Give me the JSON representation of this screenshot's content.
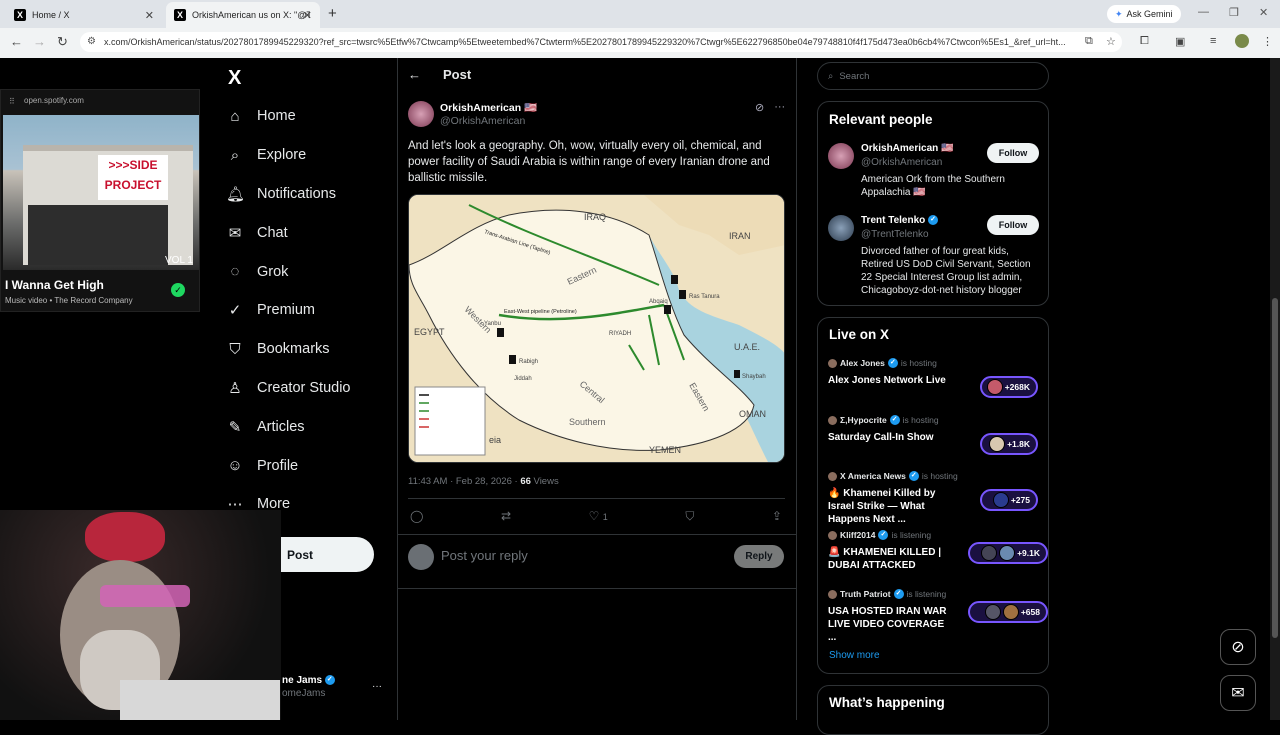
{
  "browser": {
    "tabs": [
      {
        "label": "Home / X"
      },
      {
        "label": "OrkishAmerican us on X: \"@Tre"
      }
    ],
    "new_tab": "+",
    "gemini": "Ask Gemini",
    "url": "x.com/OrkishAmerican/status/2027801789945229320?ref_src=twsrc%5Etfw%7Ctwcamp%5Etweetembed%7Ctwterm%5E2027801789945229320%7Ctwgr%5E622796850be04e79748810f4f175d473ea0b6cb4%7Ctwcon%5Es1_&ref_url=ht..."
  },
  "spotify": {
    "domain": "open.spotify.com",
    "album_sign": ">>>SIDE PROJECT",
    "album_vol": "VOL 1",
    "song": "I Wanna Get High",
    "meta": "Music video • The Record Company"
  },
  "sidebar": {
    "logo": "X",
    "items": [
      {
        "label": "Home",
        "icon": "⌂"
      },
      {
        "label": "Explore",
        "icon": "⌕"
      },
      {
        "label": "Notifications",
        "icon": "🔔︎"
      },
      {
        "label": "Chat",
        "icon": "✉"
      },
      {
        "label": "Grok",
        "icon": "◌"
      },
      {
        "label": "Premium",
        "icon": "✓"
      },
      {
        "label": "Bookmarks",
        "icon": "⛉"
      },
      {
        "label": "Creator Studio",
        "icon": "♙"
      },
      {
        "label": "Articles",
        "icon": "✎"
      },
      {
        "label": "Profile",
        "icon": "☺"
      },
      {
        "label": "More",
        "icon": "⋯"
      }
    ],
    "post_button": "Post",
    "account_name": "ne Jams",
    "account_handle": "omeJams"
  },
  "post": {
    "header": "Post",
    "author_name": "OrkishAmerican 🇺🇸",
    "author_handle": "@OrkishAmerican",
    "text": "And let's look a geography. Oh, wow, virtually every oil, chemical, and power facility of Saudi Arabia is within range of every Iranian drone and ballistic missile.",
    "timestamp": "11:43 AM · Feb 28, 2026 · ",
    "views_count": "66",
    "views_label": " Views",
    "likes": "1",
    "reply_placeholder": "Post your reply",
    "reply_button": "Reply",
    "map": {
      "labels": [
        "IRAQ",
        "IRAN",
        "EGYPT",
        "Western",
        "Eastern",
        "Central",
        "Southern",
        "Eastern",
        "U.A.E.",
        "OMAN",
        "YEMEN",
        "Ras Tanura",
        "Abqaiq",
        "RIYADH",
        "Yanbu",
        "Rabigh",
        "Jiddah",
        "Shaybah",
        "East-West pipeline (Petroline)",
        "Trans-Arabian Line (Tapline)",
        "eia"
      ]
    }
  },
  "right": {
    "search_placeholder": "Search",
    "relevant_title": "Relevant people",
    "people": [
      {
        "name": "OrkishAmerican 🇺🇸",
        "handle": "@OrkishAmerican",
        "bio": "American Ork from the Southern Appalachia 🇺🇸",
        "follow": "Follow"
      },
      {
        "name": "Trent Telenko",
        "handle": "@TrentTelenko",
        "bio": "Divorced father of four great kids, Retired US DoD Civil Servant, Section 22 Special Interest Group list admin, Chicagoboyz-dot-net history blogger",
        "follow": "Follow"
      }
    ],
    "live_title": "Live on X",
    "live": [
      {
        "host": "Alex Jones",
        "status": "is hosting",
        "title": "Alex Jones Network Live",
        "count": "+268K"
      },
      {
        "host": "Σ,Hypocrite",
        "status": "is hosting",
        "title": "Saturday Call-In Show",
        "count": "+1.8K"
      },
      {
        "host": "X America News",
        "status": "is hosting",
        "title": "🔥 Khamenei Killed by Israel Strike — What Happens Next ...",
        "count": "+275"
      },
      {
        "host": "Kliff2014",
        "status": "is listening",
        "title": "🚨 KHAMENEI KILLED | DUBAI ATTACKED",
        "count": "+9.1K"
      },
      {
        "host": "Truth Patriot",
        "status": "is listening",
        "title": "USA HOSTED IRAN WAR LIVE VIDEO COVERAGE ...",
        "count": "+658"
      }
    ],
    "show_more": "Show more",
    "happening_title": "What’s happening"
  }
}
